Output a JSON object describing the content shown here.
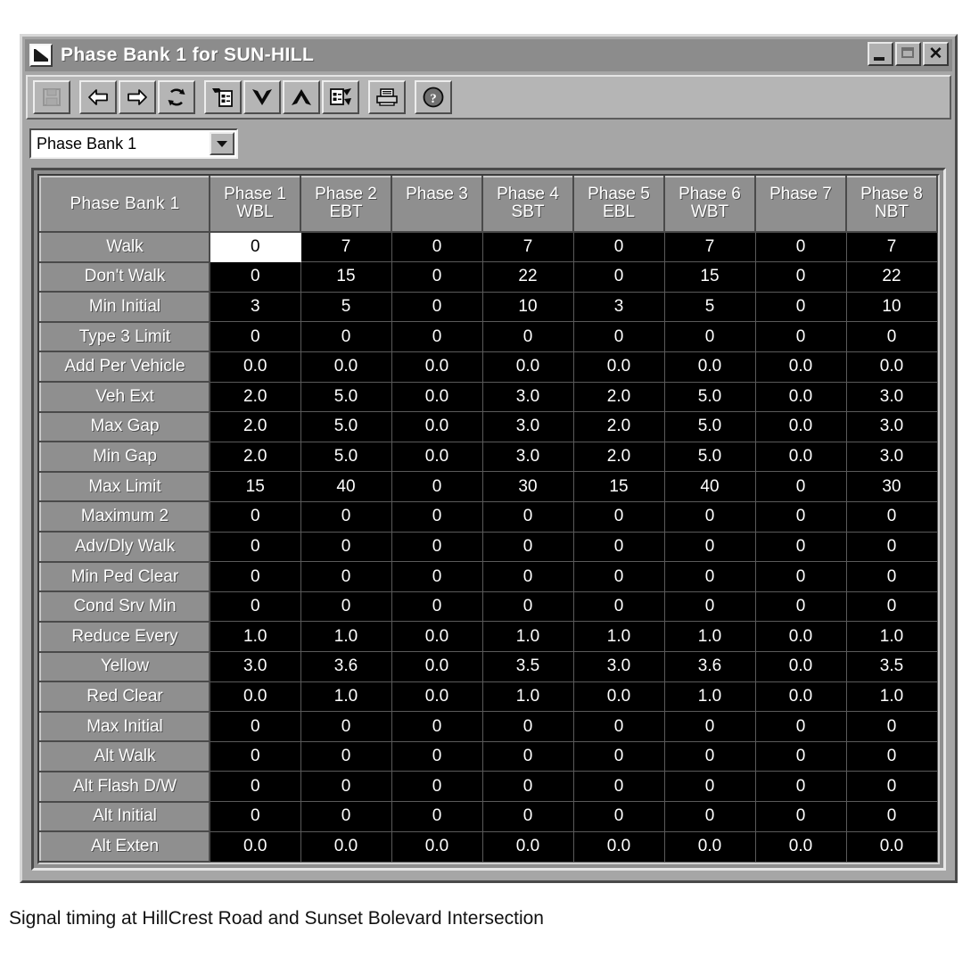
{
  "window": {
    "title": "Phase Bank 1 for SUN-HILL",
    "sysmenu_icon": "window-sysmenu-icon",
    "buttons": {
      "minimize": "minimize-icon",
      "maximize": "maximize-icon",
      "close": "✕"
    }
  },
  "toolbar": {
    "items": [
      {
        "name": "save-button",
        "icon": "save-disk-icon",
        "disabled": true
      },
      {
        "name": "previous-button",
        "icon": "arrow-left-icon",
        "disabled": false
      },
      {
        "name": "next-button",
        "icon": "arrow-right-icon",
        "disabled": false
      },
      {
        "name": "refresh-button",
        "icon": "refresh-icon",
        "disabled": false
      },
      {
        "name": "copy-data-button",
        "icon": "copy-document-icon",
        "disabled": false
      },
      {
        "name": "move-down-button",
        "icon": "chevron-down-icon",
        "disabled": false
      },
      {
        "name": "move-up-button",
        "icon": "chevron-up-icon",
        "disabled": false
      },
      {
        "name": "send-document-button",
        "icon": "document-send-icon",
        "disabled": false
      },
      {
        "name": "print-button",
        "icon": "printer-icon",
        "disabled": false
      },
      {
        "name": "help-button",
        "icon": "help-question-icon",
        "disabled": false
      }
    ]
  },
  "selector": {
    "value": "Phase Bank 1",
    "arrow_icon": "chevron-down-icon"
  },
  "table": {
    "corner_label": "Phase Bank 1",
    "columns": [
      {
        "phase": "Phase 1",
        "direction": "WBL"
      },
      {
        "phase": "Phase 2",
        "direction": "EBT"
      },
      {
        "phase": "Phase 3",
        "direction": ""
      },
      {
        "phase": "Phase 4",
        "direction": "SBT"
      },
      {
        "phase": "Phase 5",
        "direction": "EBL"
      },
      {
        "phase": "Phase 6",
        "direction": "WBT"
      },
      {
        "phase": "Phase 7",
        "direction": ""
      },
      {
        "phase": "Phase 8",
        "direction": "NBT"
      }
    ],
    "selected_cell": {
      "row": 0,
      "col": 0
    },
    "rows": [
      {
        "label": "Walk",
        "values": [
          "0",
          "7",
          "0",
          "7",
          "0",
          "7",
          "0",
          "7"
        ]
      },
      {
        "label": "Don't Walk",
        "values": [
          "0",
          "15",
          "0",
          "22",
          "0",
          "15",
          "0",
          "22"
        ]
      },
      {
        "label": "Min Initial",
        "values": [
          "3",
          "5",
          "0",
          "10",
          "3",
          "5",
          "0",
          "10"
        ]
      },
      {
        "label": "Type 3 Limit",
        "values": [
          "0",
          "0",
          "0",
          "0",
          "0",
          "0",
          "0",
          "0"
        ]
      },
      {
        "label": "Add Per Vehicle",
        "values": [
          "0.0",
          "0.0",
          "0.0",
          "0.0",
          "0.0",
          "0.0",
          "0.0",
          "0.0"
        ]
      },
      {
        "label": "Veh Ext",
        "values": [
          "2.0",
          "5.0",
          "0.0",
          "3.0",
          "2.0",
          "5.0",
          "0.0",
          "3.0"
        ]
      },
      {
        "label": "Max Gap",
        "values": [
          "2.0",
          "5.0",
          "0.0",
          "3.0",
          "2.0",
          "5.0",
          "0.0",
          "3.0"
        ]
      },
      {
        "label": "Min Gap",
        "values": [
          "2.0",
          "5.0",
          "0.0",
          "3.0",
          "2.0",
          "5.0",
          "0.0",
          "3.0"
        ]
      },
      {
        "label": "Max Limit",
        "values": [
          "15",
          "40",
          "0",
          "30",
          "15",
          "40",
          "0",
          "30"
        ]
      },
      {
        "label": "Maximum 2",
        "values": [
          "0",
          "0",
          "0",
          "0",
          "0",
          "0",
          "0",
          "0"
        ]
      },
      {
        "label": "Adv/Dly Walk",
        "values": [
          "0",
          "0",
          "0",
          "0",
          "0",
          "0",
          "0",
          "0"
        ]
      },
      {
        "label": "Min Ped Clear",
        "values": [
          "0",
          "0",
          "0",
          "0",
          "0",
          "0",
          "0",
          "0"
        ]
      },
      {
        "label": "Cond Srv Min",
        "values": [
          "0",
          "0",
          "0",
          "0",
          "0",
          "0",
          "0",
          "0"
        ]
      },
      {
        "label": "Reduce Every",
        "values": [
          "1.0",
          "1.0",
          "0.0",
          "1.0",
          "1.0",
          "1.0",
          "0.0",
          "1.0"
        ]
      },
      {
        "label": "Yellow",
        "values": [
          "3.0",
          "3.6",
          "0.0",
          "3.5",
          "3.0",
          "3.6",
          "0.0",
          "3.5"
        ]
      },
      {
        "label": "Red Clear",
        "values": [
          "0.0",
          "1.0",
          "0.0",
          "1.0",
          "0.0",
          "1.0",
          "0.0",
          "1.0"
        ]
      },
      {
        "label": "Max Initial",
        "values": [
          "0",
          "0",
          "0",
          "0",
          "0",
          "0",
          "0",
          "0"
        ]
      },
      {
        "label": "Alt Walk",
        "values": [
          "0",
          "0",
          "0",
          "0",
          "0",
          "0",
          "0",
          "0"
        ]
      },
      {
        "label": "Alt Flash D/W",
        "values": [
          "0",
          "0",
          "0",
          "0",
          "0",
          "0",
          "0",
          "0"
        ]
      },
      {
        "label": "Alt Initial",
        "values": [
          "0",
          "0",
          "0",
          "0",
          "0",
          "0",
          "0",
          "0"
        ]
      },
      {
        "label": "Alt Exten",
        "values": [
          "0.0",
          "0.0",
          "0.0",
          "0.0",
          "0.0",
          "0.0",
          "0.0",
          "0.0"
        ]
      }
    ]
  },
  "caption": "Signal timing at HillCrest Road and Sunset Bolevard Intersection",
  "colors": {
    "window_face": "#a6a6a6",
    "titlebar": "#8c8c8c",
    "header_face": "#8f8f8f",
    "grid_background": "#000000",
    "grid_text": "#ffffff",
    "selected_cell_background": "#ffffff",
    "selected_cell_text": "#000000"
  }
}
